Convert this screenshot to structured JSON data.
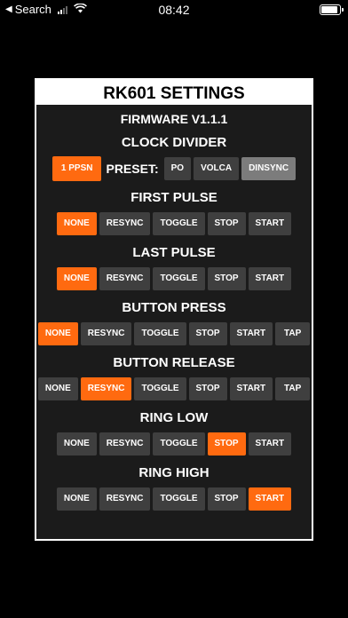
{
  "status_bar": {
    "back_label": "Search",
    "time": "08:42",
    "battery_level": 0.9
  },
  "panel": {
    "title": "RK601 SETTINGS",
    "firmware": "FIRMWARE V1.1.1"
  },
  "clock_divider": {
    "title": "CLOCK DIVIDER",
    "ppsn_label": "1 PPSN",
    "preset_label": "PRESET:",
    "presets": [
      "PO",
      "VOLCA",
      "DINSYNC"
    ]
  },
  "sections": {
    "first_pulse": {
      "title": "FIRST PULSE",
      "options": [
        "NONE",
        "RESYNC",
        "TOGGLE",
        "STOP",
        "START"
      ],
      "selected": "NONE"
    },
    "last_pulse": {
      "title": "LAST PULSE",
      "options": [
        "NONE",
        "RESYNC",
        "TOGGLE",
        "STOP",
        "START"
      ],
      "selected": "NONE"
    },
    "button_press": {
      "title": "BUTTON PRESS",
      "options": [
        "NONE",
        "RESYNC",
        "TOGGLE",
        "STOP",
        "START",
        "TAP"
      ],
      "selected": "NONE"
    },
    "button_release": {
      "title": "BUTTON RELEASE",
      "options": [
        "NONE",
        "RESYNC",
        "TOGGLE",
        "STOP",
        "START",
        "TAP"
      ],
      "selected": "RESYNC"
    },
    "ring_low": {
      "title": "RING LOW",
      "options": [
        "NONE",
        "RESYNC",
        "TOGGLE",
        "STOP",
        "START"
      ],
      "selected": "STOP"
    },
    "ring_high": {
      "title": "RING HIGH",
      "options": [
        "NONE",
        "RESYNC",
        "TOGGLE",
        "STOP",
        "START"
      ],
      "selected": "START"
    }
  },
  "colors": {
    "accent": "#ff6a10",
    "button": "#3f3f3f",
    "button_light": "#7c7c7c",
    "panel_bg": "#1b1b1b"
  }
}
